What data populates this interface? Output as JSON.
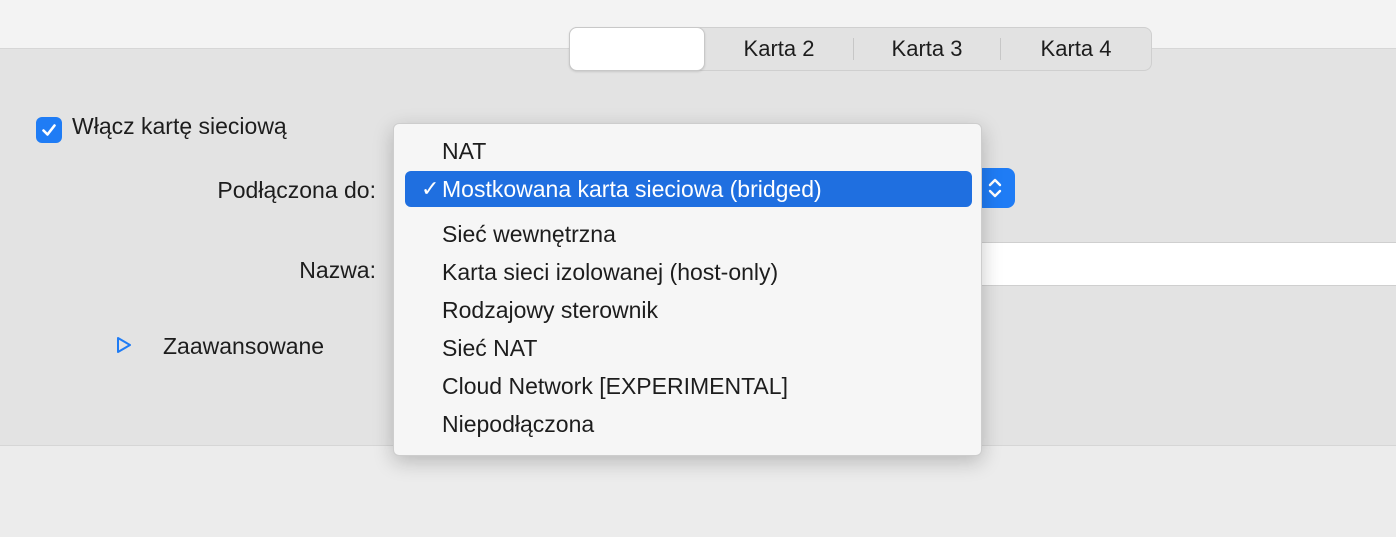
{
  "tabs": [
    {
      "label": "",
      "selected": true
    },
    {
      "label": "Karta 2"
    },
    {
      "label": "Karta 3"
    },
    {
      "label": "Karta 4"
    }
  ],
  "enable_adapter": {
    "label": "Włącz kartę sieciową",
    "checked": true
  },
  "attached_to": {
    "label": "Podłączona do:"
  },
  "name": {
    "label": "Nazwa:",
    "value": ""
  },
  "advanced": {
    "label": "Zaawansowane",
    "expanded": false
  },
  "dropdown": {
    "selected_index": 1,
    "checkmark": "✓",
    "options": [
      "NAT",
      "Mostkowana karta sieciowa (bridged)",
      "Sieć wewnętrzna",
      "Karta sieci izolowanej (host-only)",
      "Rodzajowy sterownik",
      "Sieć NAT",
      "Cloud Network [EXPERIMENTAL]",
      "Niepodłączona"
    ]
  },
  "colors": {
    "accent": "#1f7cf5",
    "menu_highlight": "#1f6fe0"
  },
  "icons": {
    "checkbox": "checkmark-icon",
    "stepper": "chevron-updown-icon",
    "disclosure": "disclosure-triangle-icon"
  }
}
